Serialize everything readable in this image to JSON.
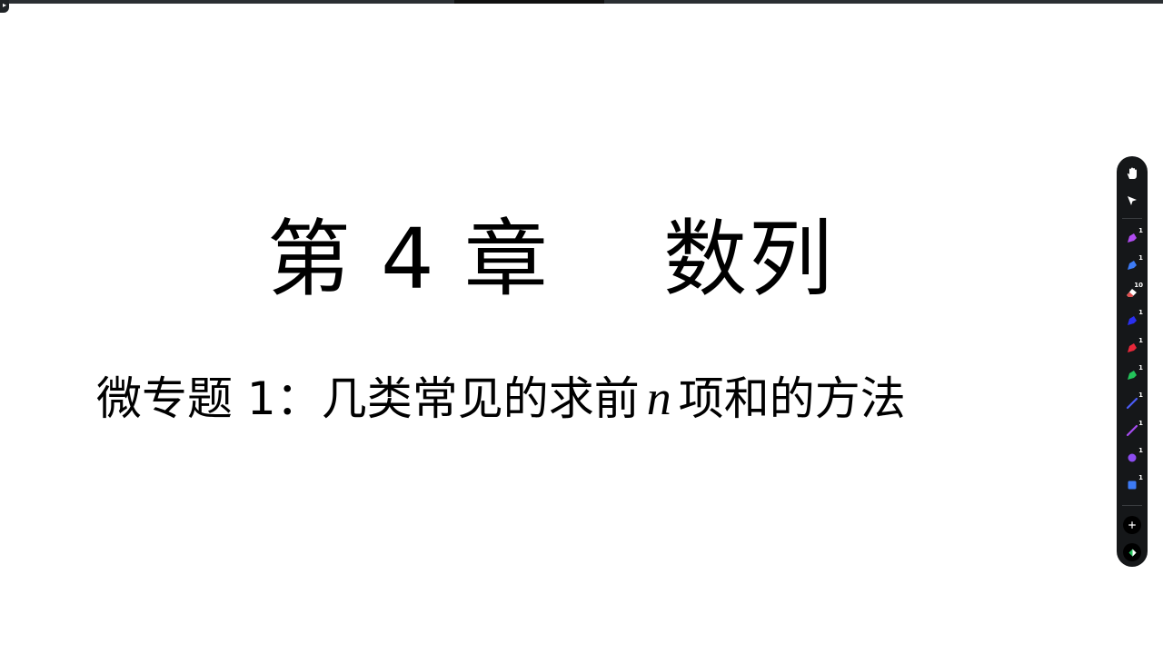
{
  "slide": {
    "title": "第 4 章　 数列",
    "subtitle_before": "微专题 1：几类常见的求前",
    "subtitle_var": "n",
    "subtitle_after": "项和的方法"
  },
  "toolbar": {
    "tools": [
      {
        "name": "hand-tool",
        "icon": "hand-icon",
        "badge": ""
      },
      {
        "name": "select-tool",
        "icon": "cursor-arrow-icon",
        "badge": ""
      },
      {
        "name": "pen-purple",
        "icon": "pen-icon",
        "color": "#b04cf0",
        "badge": "1"
      },
      {
        "name": "pen-blue",
        "icon": "pen-icon",
        "color": "#3d7bf5",
        "badge": "1"
      },
      {
        "name": "eraser-tool",
        "icon": "eraser-icon",
        "color": "#ffffff",
        "badge": "10"
      },
      {
        "name": "pen-dark-blue",
        "icon": "pen-icon",
        "color": "#2a2ff0",
        "badge": "1"
      },
      {
        "name": "pen-red",
        "icon": "pen-icon",
        "color": "#e8283a",
        "badge": "1"
      },
      {
        "name": "pen-green",
        "icon": "pen-icon",
        "color": "#23c35a",
        "badge": "1"
      },
      {
        "name": "line-blue",
        "icon": "line-icon",
        "color": "#4a5cf5",
        "badge": "1"
      },
      {
        "name": "line-purple",
        "icon": "line-icon",
        "color": "#a64cf0",
        "badge": "1"
      },
      {
        "name": "circle-purple",
        "icon": "circle-icon",
        "color": "#8c4cf0",
        "badge": "1"
      },
      {
        "name": "square-blue",
        "icon": "square-icon",
        "color": "#3d7bf5",
        "badge": "1"
      }
    ],
    "add_icon": "plus-icon",
    "bottom_icon": "shape-icon"
  }
}
